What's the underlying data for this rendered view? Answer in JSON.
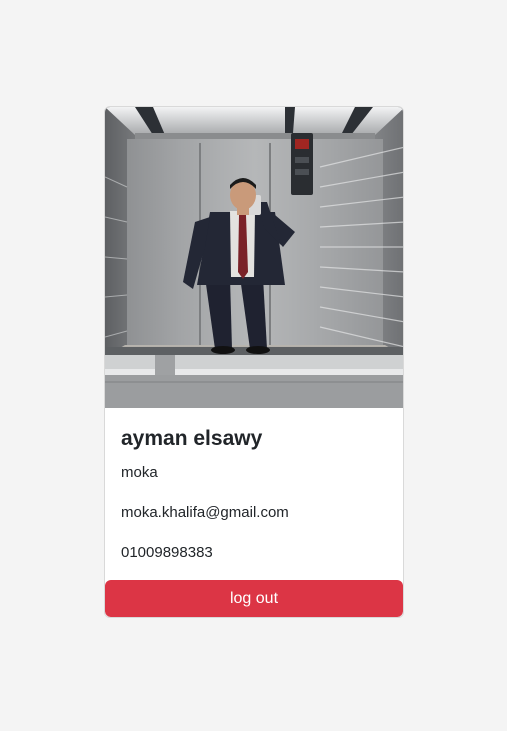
{
  "profile": {
    "name": "ayman elsawy",
    "username": "moka",
    "email": "moka.khalifa@gmail.com",
    "phone": "01009898383"
  },
  "actions": {
    "logout_label": "log out"
  },
  "colors": {
    "page_background": "#f4f4f4",
    "card_background": "#ffffff",
    "logout_button": "#dc3545"
  }
}
